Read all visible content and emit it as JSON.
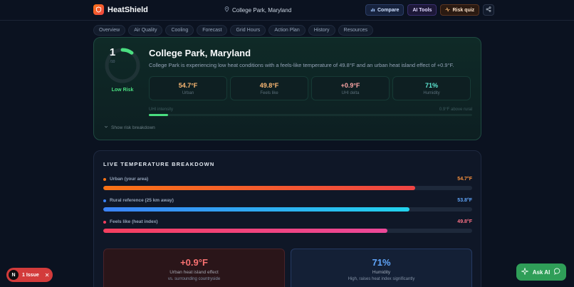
{
  "header": {
    "brand": "HeatShield",
    "location": "College Park, Maryland",
    "compare_label": "Compare",
    "ai_tools_label": "AI Tools",
    "risk_quiz_label": "Risk quiz"
  },
  "tabs": [
    {
      "label": "Overview"
    },
    {
      "label": "Air Quality"
    },
    {
      "label": "Cooling"
    },
    {
      "label": "Forecast"
    },
    {
      "label": "Grid Hours"
    },
    {
      "label": "Action Plan"
    },
    {
      "label": "History"
    },
    {
      "label": "Resources"
    }
  ],
  "hero": {
    "risk_score": "1",
    "risk_max": "/10",
    "risk_fraction": 0.1,
    "risk_label": "Low Risk",
    "title": "College Park, Maryland",
    "description": "College Park is experiencing low heat conditions with a feels-like temperature of 49.8°F and an urban heat island effect of +0.9°F.",
    "stats": [
      {
        "value": "54.7°F",
        "label": "Urban",
        "color": "#fdba74"
      },
      {
        "value": "49.8°F",
        "label": "Feels like",
        "color": "#fdba74"
      },
      {
        "value": "+0.9°F",
        "label": "UHI delta",
        "color": "#fca5a5"
      },
      {
        "value": "71%",
        "label": "Humidity",
        "color": "#5eead4"
      }
    ],
    "uhi_label": "UHI intensity",
    "uhi_note": "0.9°F above rural",
    "uhi_fraction": 0.06,
    "breakdown_toggle": "Show risk breakdown"
  },
  "live": {
    "title": "LIVE TEMPERATURE BREAKDOWN",
    "rows": [
      {
        "name": "Urban (your area)",
        "value": "54.7°F",
        "fraction": 0.845,
        "dot": "#f97316",
        "value_color": "#fb923c",
        "gradient": "linear-gradient(90deg,#f97316,#ef4444)"
      },
      {
        "name": "Rural reference (25 km away)",
        "value": "53.8°F",
        "fraction": 0.83,
        "dot": "#3b82f6",
        "value_color": "#60a5fa",
        "gradient": "linear-gradient(90deg,#3b82f6,#22d3ee)"
      },
      {
        "name": "Feels like (heat index)",
        "value": "49.8°F",
        "fraction": 0.77,
        "dot": "#f43f5e",
        "value_color": "#fb7185",
        "gradient": "linear-gradient(90deg,#f43f5e,#ec4899)"
      }
    ],
    "cards": [
      {
        "value": "+0.9°F",
        "label": "Urban heat island effect",
        "sub": "vs. surrounding countryside",
        "color": "#f87171"
      },
      {
        "value": "71%",
        "label": "Humidity",
        "sub": "High, raises heat index significantly",
        "color": "#60a5fa"
      }
    ]
  },
  "issue_badge": {
    "initial": "N",
    "label": "1 Issue"
  },
  "ask_ai": {
    "label": "Ask AI"
  }
}
